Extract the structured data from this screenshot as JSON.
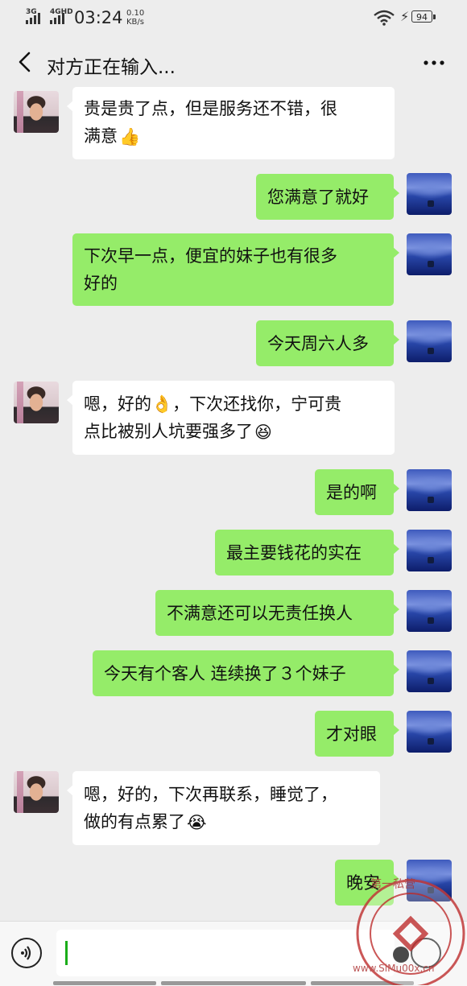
{
  "status_bar": {
    "sig1": "3G",
    "sig2": "4GHD",
    "time": "03:24",
    "net_speed_value": "0.10",
    "net_speed_unit": "KB/s",
    "battery": "94"
  },
  "header": {
    "title": "对方正在输入..."
  },
  "messages": [
    {
      "side": "in",
      "lines": [
        "贵是贵了点，但是服务还不错，很",
        "满意"
      ],
      "emoji": "👍"
    },
    {
      "side": "out",
      "lines": [
        "您满意了就好"
      ]
    },
    {
      "side": "out",
      "lines": [
        "下次早一点，便宜的妹子也有很多",
        "好的"
      ]
    },
    {
      "side": "out",
      "lines": [
        "今天周六人多"
      ]
    },
    {
      "side": "in",
      "lines": [
        "嗯，好的👌，下次还找你，宁可贵",
        "点比被别人坑要强多了"
      ],
      "emoji": "😆"
    },
    {
      "side": "out",
      "lines": [
        "是的啊"
      ]
    },
    {
      "side": "out",
      "lines": [
        "最主要钱花的实在"
      ]
    },
    {
      "side": "out",
      "lines": [
        "不满意还可以无责任换人"
      ]
    },
    {
      "side": "out",
      "lines": [
        "今天有个客人 连续换了３个妹子"
      ]
    },
    {
      "side": "out",
      "lines": [
        "才对眼"
      ]
    },
    {
      "side": "in",
      "lines": [
        "嗯，好的，下次再联系，睡觉了，",
        "做的有点累了"
      ],
      "emoji": "😭"
    },
    {
      "side": "out",
      "lines": [
        "晚安"
      ]
    }
  ],
  "watermark": {
    "top_text": "第一私营",
    "bottom_text": "www.SiMu00x.cn"
  },
  "colors": {
    "background": "#ededed",
    "bubble_out": "#95ec69",
    "bubble_in": "#ffffff",
    "cursor": "#1aad19"
  },
  "icons": {
    "back": "chevron-left-icon",
    "more": "more-dots-icon",
    "voice": "voice-icon",
    "wifi": "wifi-icon",
    "battery": "battery-icon"
  }
}
